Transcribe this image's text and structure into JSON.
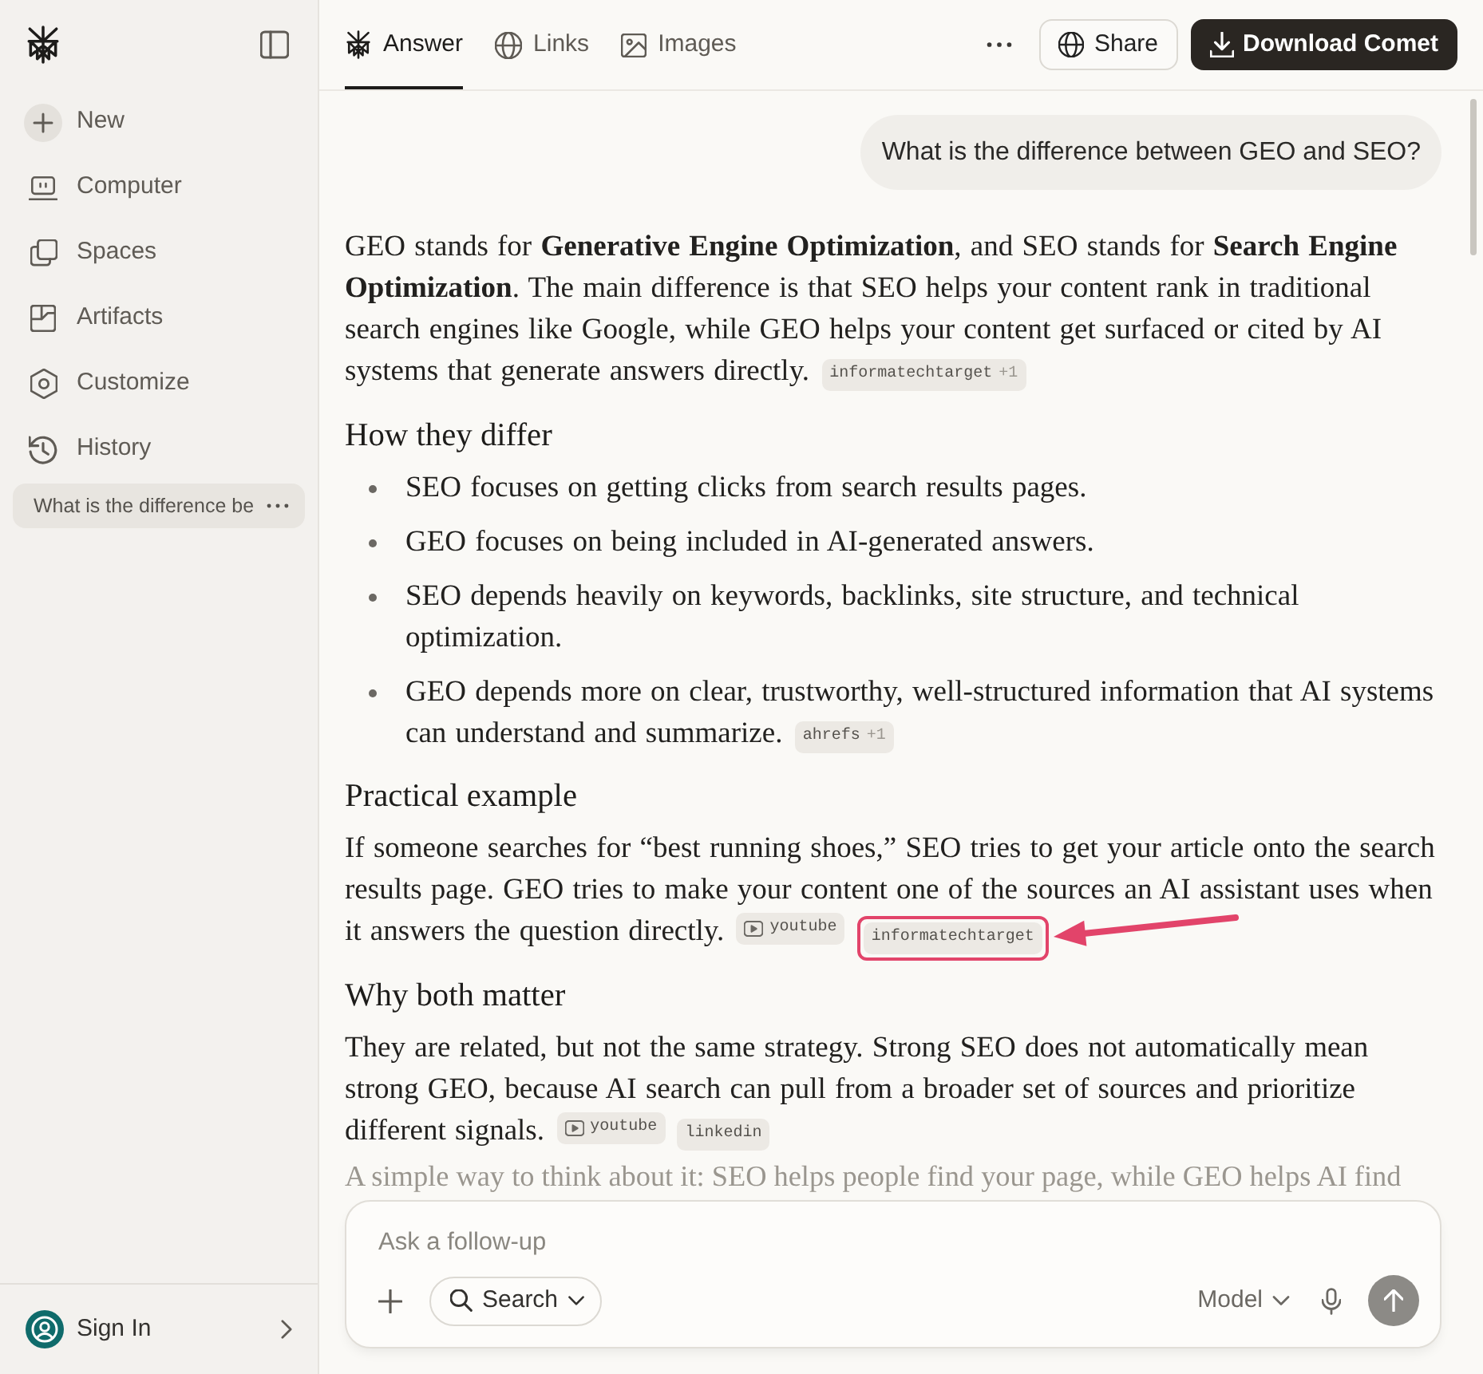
{
  "sidebar": {
    "items": [
      {
        "kind": "new",
        "label": "New"
      },
      {
        "kind": "computer",
        "label": "Computer"
      },
      {
        "kind": "spaces",
        "label": "Spaces"
      },
      {
        "kind": "artifacts",
        "label": "Artifacts"
      },
      {
        "kind": "customize",
        "label": "Customize"
      },
      {
        "kind": "history",
        "label": "History"
      }
    ],
    "threads": [
      {
        "title": "What is the difference be",
        "selected": true
      }
    ],
    "account": {
      "label": "Sign In"
    }
  },
  "tabs": [
    {
      "label": "Answer",
      "kind": "answer",
      "selected": true
    },
    {
      "label": "Links",
      "kind": "links",
      "selected": false
    },
    {
      "label": "Images",
      "kind": "images",
      "selected": false
    }
  ],
  "actions": {
    "share": "Share",
    "download": "Download Comet"
  },
  "question": "What is the difference between GEO and SEO?",
  "answer": [
    {
      "kind": "paragraph",
      "faded": false,
      "text": "GEO stands for **Generative Engine Optimization**, and SEO stands for **Search Engine Optimization**. The main difference is that SEO helps your content rank in traditional search engines like Google, while GEO helps your content get surfaced or cited by AI systems that generate answers directly.",
      "citations": [
        {
          "kind": "web",
          "source": "informatechtarget",
          "extra": "+1",
          "highlighted": false
        }
      ]
    },
    {
      "kind": "heading",
      "text": "How they differ"
    },
    {
      "kind": "list",
      "items": [
        {
          "text": "SEO focuses on getting clicks from search results pages."
        },
        {
          "text": "GEO focuses on being included in AI-generated answers."
        },
        {
          "text": "SEO depends heavily on keywords, backlinks, site structure, and technical optimization."
        },
        {
          "text": "GEO depends more on clear, trustworthy, well-structured information that AI systems can understand and summarize.",
          "citations": [
            {
              "kind": "web",
              "source": "ahrefs",
              "extra": "+1",
              "highlighted": false
            }
          ]
        }
      ]
    },
    {
      "kind": "heading",
      "text": "Practical example"
    },
    {
      "kind": "paragraph",
      "faded": false,
      "text": "If someone searches for “best running shoes,” SEO tries to get your article onto the search results page. GEO tries to make your content one of the sources an AI assistant uses when it answers the question directly.",
      "citations": [
        {
          "kind": "video",
          "source": "youtube",
          "highlighted": false
        },
        {
          "kind": "web",
          "source": "informatechtarget",
          "highlighted": true
        }
      ]
    },
    {
      "kind": "heading",
      "text": "Why both matter"
    },
    {
      "kind": "paragraph",
      "faded": false,
      "text": "They are related, but not the same strategy. Strong SEO does not automatically mean strong GEO, because AI search can pull from a broader set of sources and prioritize different signals.",
      "citations": [
        {
          "kind": "video",
          "source": "youtube",
          "highlighted": false
        },
        {
          "kind": "web",
          "source": "linkedin",
          "highlighted": false
        }
      ]
    },
    {
      "kind": "paragraph",
      "faded": true,
      "text": "A simple way to think about it: SEO helps people find your page, while GEO helps AI find"
    }
  ],
  "composer": {
    "placeholder": "Ask a follow-up",
    "search": "Search",
    "model": "Model",
    "send_disabled": true
  }
}
